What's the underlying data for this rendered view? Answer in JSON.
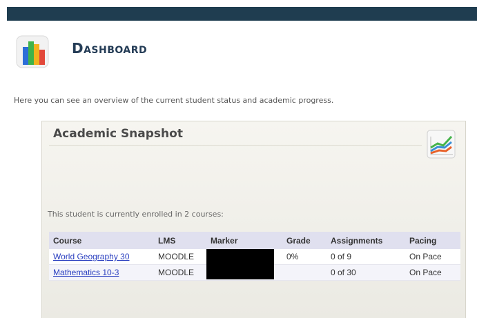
{
  "header": {
    "title": "Dashboard",
    "icon": "bar-chart-icon"
  },
  "intro": {
    "text": "Here you can see an overview of the current student status and academic progress."
  },
  "snapshot": {
    "title": "Academic Snapshot",
    "icon": "line-chart-icon",
    "enrolled_text": "This student is currently enrolled in 2 courses:",
    "columns": [
      "Course",
      "LMS",
      "Marker",
      "Grade",
      "Assignments",
      "Pacing"
    ],
    "rows": [
      {
        "course": "World Geography 30",
        "lms": "MOODLE",
        "marker": "",
        "grade": "0%",
        "assignments": "0 of 9",
        "pacing": "On Pace"
      },
      {
        "course": "Mathematics 10-3",
        "lms": "MOODLE",
        "marker": "",
        "grade": "",
        "assignments": "0 of 30",
        "pacing": "On Pace"
      }
    ]
  },
  "colors": {
    "topbar": "#1f3d50",
    "title": "#243c56",
    "link": "#2a3fc0",
    "table_header": "#e0e0ef"
  }
}
